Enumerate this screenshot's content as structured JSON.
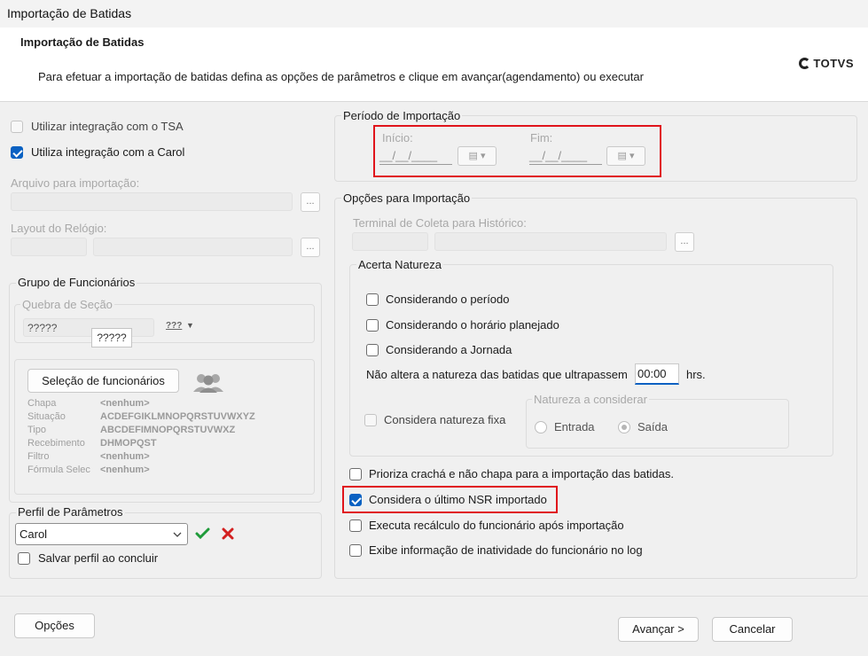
{
  "window": {
    "title": "Importação de Batidas"
  },
  "header": {
    "title": "Importação de Batidas",
    "description": "Para efetuar a importação de batidas defina as opções de parâmetros e clique em avançar(agendamento) ou executar",
    "logo_text": "TOTVS"
  },
  "left": {
    "tsa_label": "Utilizar integração com o TSA",
    "tsa_checked": false,
    "carol_label": "Utiliza integração com a Carol",
    "carol_checked": true,
    "arquivo_label": "Arquivo para importação:",
    "layout_label": "Layout do Relógio:",
    "browse_label": "...",
    "grupo": {
      "title": "Grupo de Funcionários",
      "quebra_title": "Quebra de Seção",
      "quebra_value": "?????",
      "quebra_tooltip": "?????",
      "quebra_icon_text": "???",
      "selecao_button": "Seleção de funcionários",
      "info": [
        {
          "key": "Chapa",
          "value": "<nenhum>"
        },
        {
          "key": "Situação",
          "value": "ACDEFGIKLMNOPQRSTUVWXYZ"
        },
        {
          "key": "Tipo",
          "value": "ABCDEFIMNOPQRSTUVWXZ"
        },
        {
          "key": "Recebimento",
          "value": "DHMOPQST"
        },
        {
          "key": "Filtro",
          "value": "<nenhum>"
        },
        {
          "key": "Fórmula Selec",
          "value": "<nenhum>"
        }
      ]
    },
    "perfil": {
      "title": "Perfil de Parâmetros",
      "selected": "Carol",
      "salvar_label": "Salvar perfil ao concluir",
      "salvar_checked": false
    }
  },
  "right": {
    "periodo": {
      "title": "Período de Importação",
      "inicio_label": "Início:",
      "fim_label": "Fim:",
      "inicio_value": "__/__/____",
      "fim_value": "__/__/____"
    },
    "opcoes": {
      "title": "Opções para Importação",
      "terminal_label": "Terminal de Coleta para Histórico:",
      "acerta": {
        "title": "Acerta Natureza",
        "items": [
          {
            "label": "Considerando o período",
            "checked": false
          },
          {
            "label": "Considerando o horário planejado",
            "checked": false
          },
          {
            "label": "Considerando a Jornada",
            "checked": false
          }
        ],
        "nao_altera_label": "Não altera a natureza das batidas que ultrapassem",
        "hours_value": "00:00",
        "hrs_label": "hrs.",
        "fixa_label": "Considera natureza fixa",
        "natureza_title": "Natureza a considerar",
        "entrada_label": "Entrada",
        "saida_label": "Saída",
        "selected": "Saída"
      },
      "items": [
        {
          "label": "Prioriza crachá e não chapa para a importação das batidas.",
          "checked": false
        },
        {
          "label": "Considera o último NSR importado",
          "checked": true
        },
        {
          "label": "Executa recálculo do funcionário após importação",
          "checked": false
        },
        {
          "label": "Exibe informação de inatividade do funcionário no log",
          "checked": false
        }
      ]
    }
  },
  "footer": {
    "opcoes_button": "Opções",
    "avancar_button": "Avançar >",
    "cancelar_button": "Cancelar"
  },
  "colors": {
    "accent": "#0a61c2",
    "highlight_border": "#e0141b",
    "ok_icon": "#1f9b3a",
    "cancel_icon": "#d32020"
  }
}
